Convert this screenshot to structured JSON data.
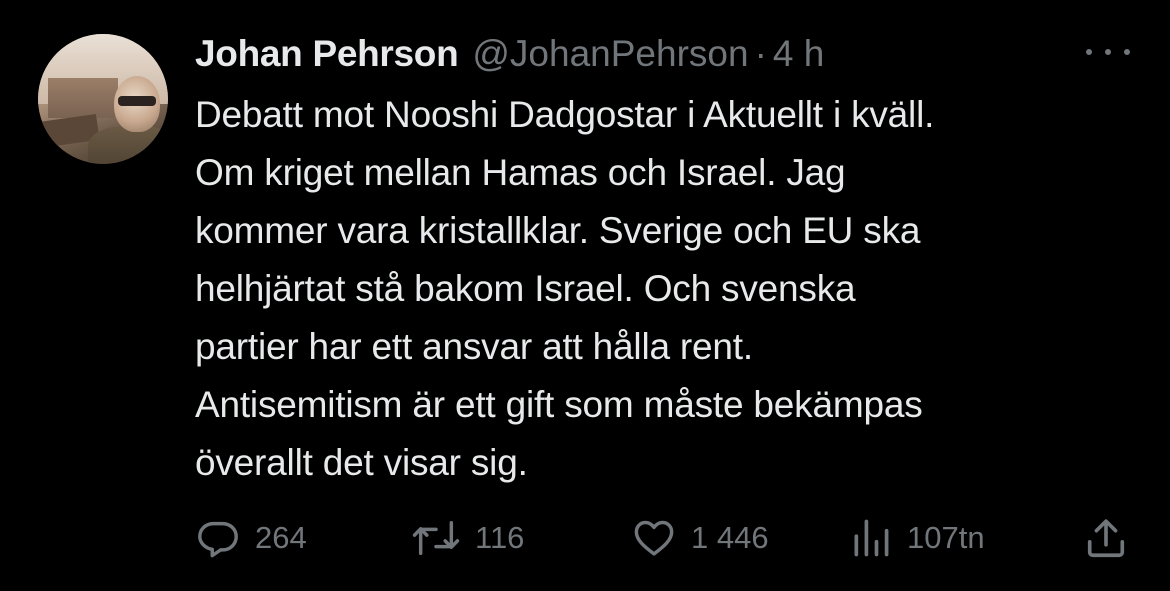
{
  "author": {
    "name": "Johan Pehrson",
    "handle": "@JohanPehrson",
    "separator": "·",
    "time": "4 h"
  },
  "tweet": {
    "lines": [
      "Debatt mot Nooshi Dadgostar i Aktuellt i kväll.",
      "Om kriget mellan Hamas och Israel. Jag",
      "kommer vara kristallklar. Sverige och EU ska",
      "helhjärtat stå bakom Israel. Och svenska",
      "partier har ett ansvar att hålla rent.",
      "Antisemitism är ett gift som måste bekämpas",
      "överallt det visar sig."
    ]
  },
  "actions": {
    "replies": "264",
    "retweets": "116",
    "likes": "1 446",
    "views": "107tn"
  },
  "icons": {
    "more": "more-horizontal-icon",
    "reply": "reply-bubble-icon",
    "retweet": "retweet-icon",
    "like": "heart-icon",
    "views": "views-bar-chart-icon",
    "share": "share-upload-icon"
  },
  "colors": {
    "background": "#000000",
    "primary_text": "#e7e9ea",
    "secondary_text": "#71767b"
  }
}
